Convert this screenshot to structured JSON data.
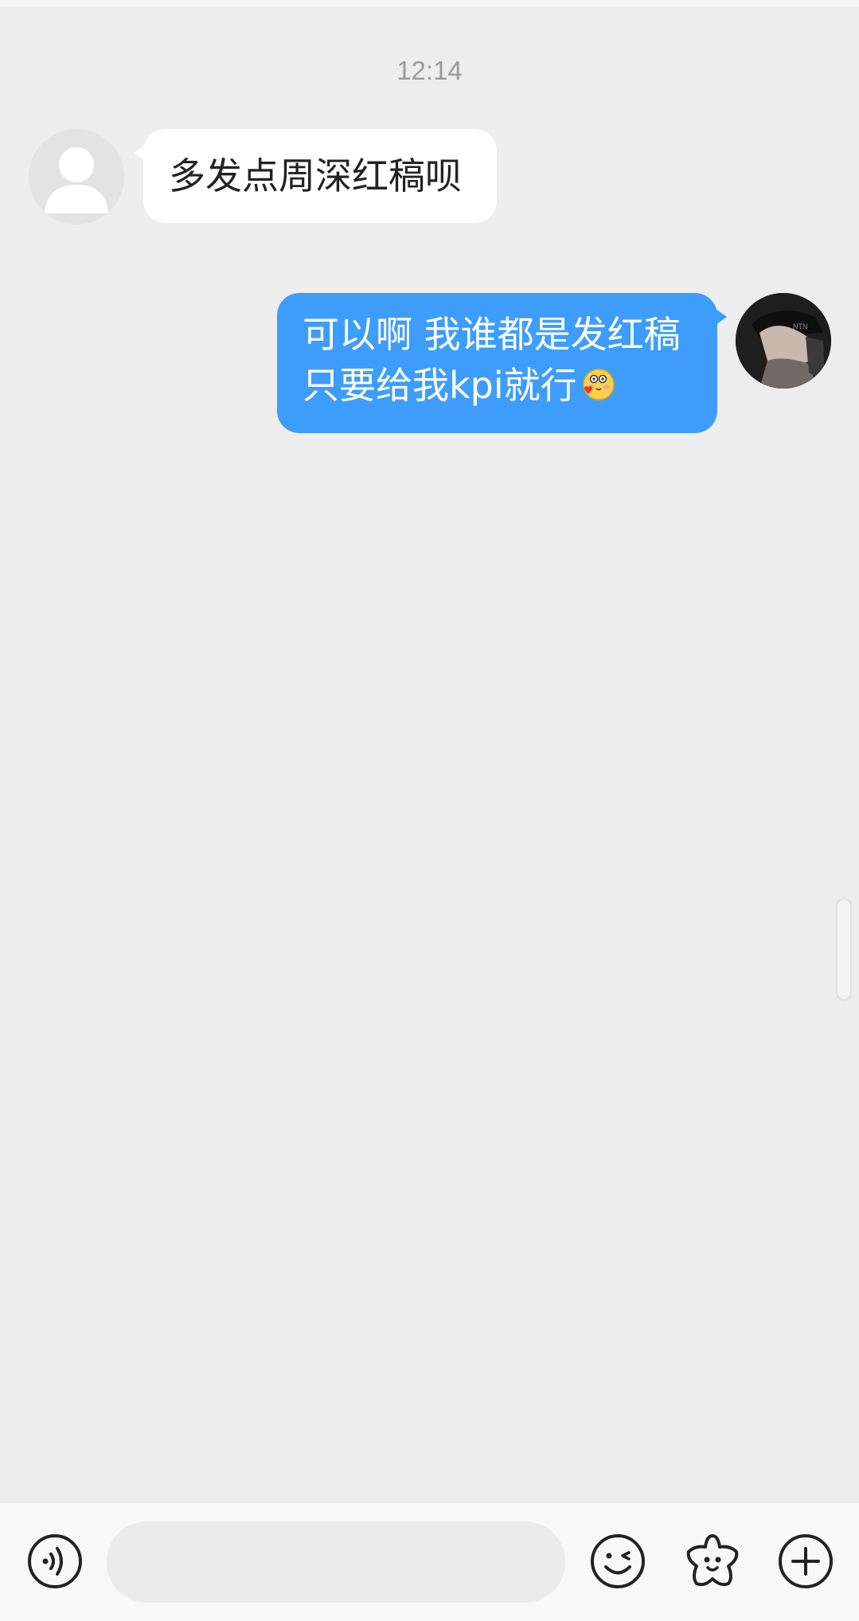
{
  "chat": {
    "timestamp": "12:14",
    "messages": [
      {
        "sender": "other",
        "lines": [
          "多发点周深红稿呗"
        ]
      },
      {
        "sender": "me",
        "lines": [
          "可以啊 我谁都是发红稿",
          "只要给我kpi就行"
        ],
        "emoji": "blush-face-emoji"
      }
    ]
  },
  "composer": {
    "placeholder": "",
    "icons": {
      "voice": "voice-icon",
      "emoji": "emoji-icon",
      "sticker": "sticker-icon",
      "add": "plus-icon"
    }
  },
  "colors": {
    "background": "#ededed",
    "outgoing_bubble": "#3e9dfb",
    "incoming_bubble": "#ffffff"
  }
}
